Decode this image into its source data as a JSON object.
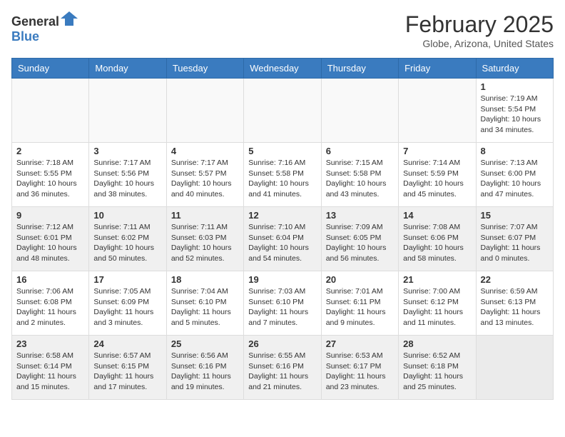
{
  "header": {
    "logo_general": "General",
    "logo_blue": "Blue",
    "month_year": "February 2025",
    "location": "Globe, Arizona, United States"
  },
  "days_of_week": [
    "Sunday",
    "Monday",
    "Tuesday",
    "Wednesday",
    "Thursday",
    "Friday",
    "Saturday"
  ],
  "weeks": [
    {
      "shaded": false,
      "days": [
        {
          "date": "",
          "info": ""
        },
        {
          "date": "",
          "info": ""
        },
        {
          "date": "",
          "info": ""
        },
        {
          "date": "",
          "info": ""
        },
        {
          "date": "",
          "info": ""
        },
        {
          "date": "",
          "info": ""
        },
        {
          "date": "1",
          "info": "Sunrise: 7:19 AM\nSunset: 5:54 PM\nDaylight: 10 hours and 34 minutes."
        }
      ]
    },
    {
      "shaded": false,
      "days": [
        {
          "date": "2",
          "info": "Sunrise: 7:18 AM\nSunset: 5:55 PM\nDaylight: 10 hours and 36 minutes."
        },
        {
          "date": "3",
          "info": "Sunrise: 7:17 AM\nSunset: 5:56 PM\nDaylight: 10 hours and 38 minutes."
        },
        {
          "date": "4",
          "info": "Sunrise: 7:17 AM\nSunset: 5:57 PM\nDaylight: 10 hours and 40 minutes."
        },
        {
          "date": "5",
          "info": "Sunrise: 7:16 AM\nSunset: 5:58 PM\nDaylight: 10 hours and 41 minutes."
        },
        {
          "date": "6",
          "info": "Sunrise: 7:15 AM\nSunset: 5:58 PM\nDaylight: 10 hours and 43 minutes."
        },
        {
          "date": "7",
          "info": "Sunrise: 7:14 AM\nSunset: 5:59 PM\nDaylight: 10 hours and 45 minutes."
        },
        {
          "date": "8",
          "info": "Sunrise: 7:13 AM\nSunset: 6:00 PM\nDaylight: 10 hours and 47 minutes."
        }
      ]
    },
    {
      "shaded": true,
      "days": [
        {
          "date": "9",
          "info": "Sunrise: 7:12 AM\nSunset: 6:01 PM\nDaylight: 10 hours and 48 minutes."
        },
        {
          "date": "10",
          "info": "Sunrise: 7:11 AM\nSunset: 6:02 PM\nDaylight: 10 hours and 50 minutes."
        },
        {
          "date": "11",
          "info": "Sunrise: 7:11 AM\nSunset: 6:03 PM\nDaylight: 10 hours and 52 minutes."
        },
        {
          "date": "12",
          "info": "Sunrise: 7:10 AM\nSunset: 6:04 PM\nDaylight: 10 hours and 54 minutes."
        },
        {
          "date": "13",
          "info": "Sunrise: 7:09 AM\nSunset: 6:05 PM\nDaylight: 10 hours and 56 minutes."
        },
        {
          "date": "14",
          "info": "Sunrise: 7:08 AM\nSunset: 6:06 PM\nDaylight: 10 hours and 58 minutes."
        },
        {
          "date": "15",
          "info": "Sunrise: 7:07 AM\nSunset: 6:07 PM\nDaylight: 11 hours and 0 minutes."
        }
      ]
    },
    {
      "shaded": false,
      "days": [
        {
          "date": "16",
          "info": "Sunrise: 7:06 AM\nSunset: 6:08 PM\nDaylight: 11 hours and 2 minutes."
        },
        {
          "date": "17",
          "info": "Sunrise: 7:05 AM\nSunset: 6:09 PM\nDaylight: 11 hours and 3 minutes."
        },
        {
          "date": "18",
          "info": "Sunrise: 7:04 AM\nSunset: 6:10 PM\nDaylight: 11 hours and 5 minutes."
        },
        {
          "date": "19",
          "info": "Sunrise: 7:03 AM\nSunset: 6:10 PM\nDaylight: 11 hours and 7 minutes."
        },
        {
          "date": "20",
          "info": "Sunrise: 7:01 AM\nSunset: 6:11 PM\nDaylight: 11 hours and 9 minutes."
        },
        {
          "date": "21",
          "info": "Sunrise: 7:00 AM\nSunset: 6:12 PM\nDaylight: 11 hours and 11 minutes."
        },
        {
          "date": "22",
          "info": "Sunrise: 6:59 AM\nSunset: 6:13 PM\nDaylight: 11 hours and 13 minutes."
        }
      ]
    },
    {
      "shaded": true,
      "days": [
        {
          "date": "23",
          "info": "Sunrise: 6:58 AM\nSunset: 6:14 PM\nDaylight: 11 hours and 15 minutes."
        },
        {
          "date": "24",
          "info": "Sunrise: 6:57 AM\nSunset: 6:15 PM\nDaylight: 11 hours and 17 minutes."
        },
        {
          "date": "25",
          "info": "Sunrise: 6:56 AM\nSunset: 6:16 PM\nDaylight: 11 hours and 19 minutes."
        },
        {
          "date": "26",
          "info": "Sunrise: 6:55 AM\nSunset: 6:16 PM\nDaylight: 11 hours and 21 minutes."
        },
        {
          "date": "27",
          "info": "Sunrise: 6:53 AM\nSunset: 6:17 PM\nDaylight: 11 hours and 23 minutes."
        },
        {
          "date": "28",
          "info": "Sunrise: 6:52 AM\nSunset: 6:18 PM\nDaylight: 11 hours and 25 minutes."
        },
        {
          "date": "",
          "info": ""
        }
      ]
    }
  ]
}
